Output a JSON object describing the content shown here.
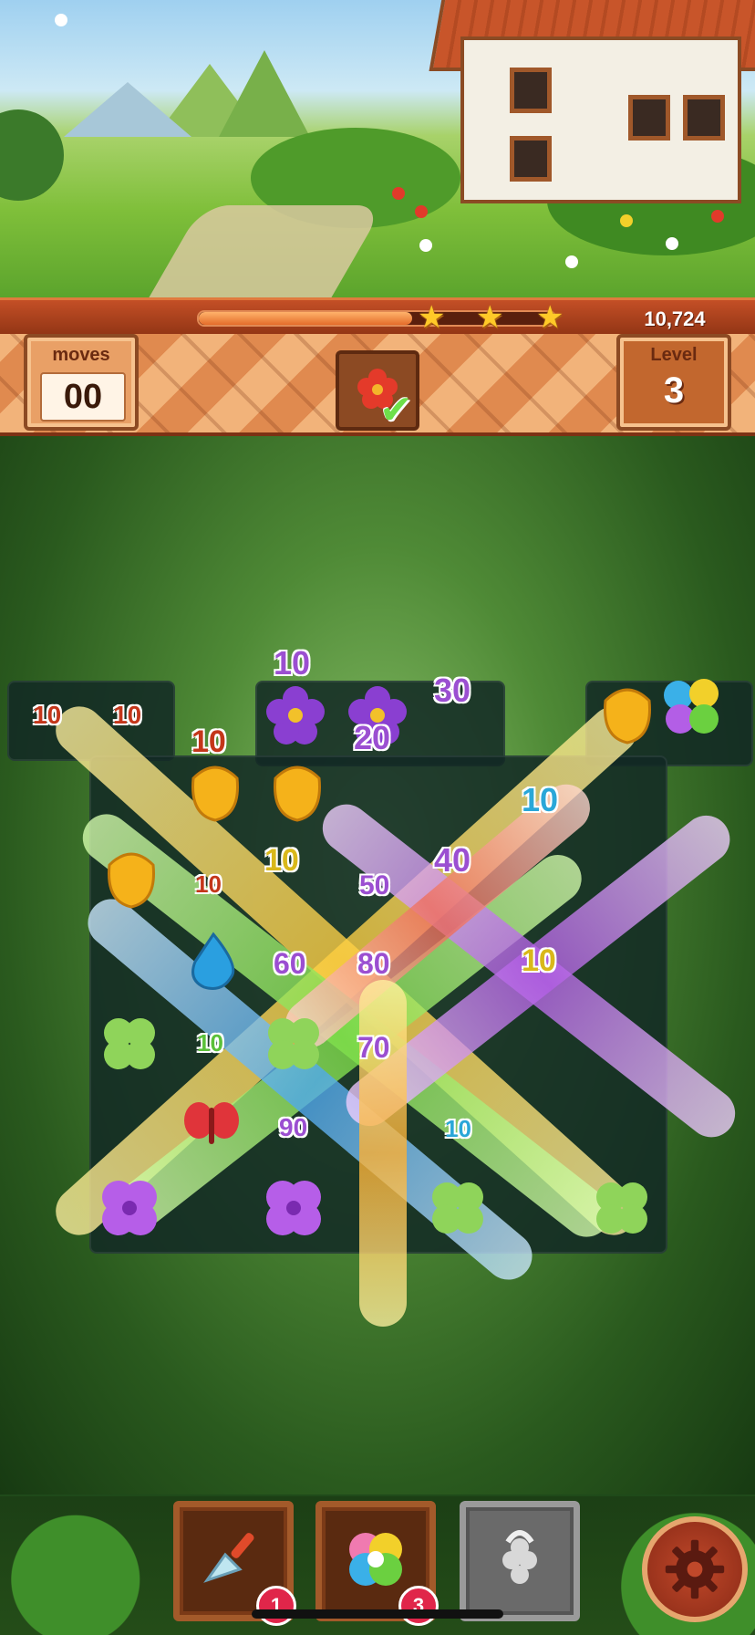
{
  "hud": {
    "score": "10,724",
    "progress": 0.6,
    "stars_earned": 3,
    "moves_label": "moves",
    "moves_value": "00",
    "level_label": "Level",
    "level_value": "3",
    "goal_icon": "red-flower-icon",
    "goal_complete": true
  },
  "score_popups": [
    {
      "text": "10",
      "color": "#c4361a"
    },
    {
      "text": "10",
      "color": "#c4361a"
    },
    {
      "text": "10",
      "color": "#9b4fd1"
    },
    {
      "text": "30",
      "color": "#9b4fd1"
    },
    {
      "text": "20",
      "color": "#9b4fd1"
    },
    {
      "text": "10",
      "color": "#c4361a"
    },
    {
      "text": "10",
      "color": "#2aa7d8"
    },
    {
      "text": "10",
      "color": "#d9b81a"
    },
    {
      "text": "40",
      "color": "#9b4fd1"
    },
    {
      "text": "10",
      "color": "#c4361a"
    },
    {
      "text": "50",
      "color": "#9b4fd1"
    },
    {
      "text": "60",
      "color": "#9b4fd1"
    },
    {
      "text": "80",
      "color": "#9b4fd1"
    },
    {
      "text": "10",
      "color": "#d9b81a"
    },
    {
      "text": "10",
      "color": "#5bc13a"
    },
    {
      "text": "70",
      "color": "#9b4fd1"
    },
    {
      "text": "90",
      "color": "#9b4fd1"
    },
    {
      "text": "10",
      "color": "#2aa7d8"
    }
  ],
  "boosters": [
    {
      "icon": "trowel-icon",
      "count": "1",
      "locked": false
    },
    {
      "icon": "rainbow-flower-icon",
      "count": "3",
      "locked": false
    },
    {
      "icon": "grape-lock-icon",
      "locked": true
    }
  ],
  "settings_icon": "gear-icon"
}
